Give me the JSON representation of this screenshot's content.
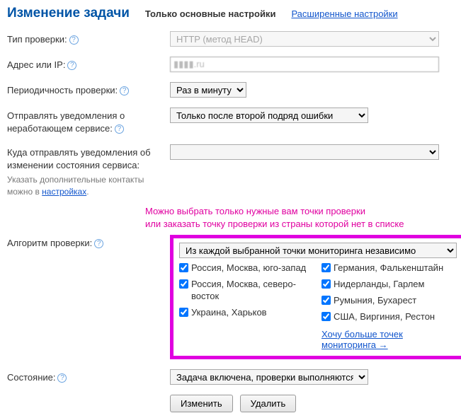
{
  "header": {
    "title": "Изменение задачи",
    "tab_basic": "Только основные настройки",
    "tab_advanced": "Расширенные настройки"
  },
  "labels": {
    "check_type": "Тип проверки:",
    "address": "Адрес или IP:",
    "frequency": "Периодичность проверки:",
    "notify_down": "Отправлять уведомления о неработающем сервисе:",
    "notify_where": "Куда отправлять уведомления об изменении состояния сервиса:",
    "notify_note_prefix": "Указать дополнительные контакты можно в ",
    "notify_note_link": "настройках",
    "algorithm": "Алгоритм проверки:",
    "state": "Состояние:"
  },
  "values": {
    "check_type": "HTTP (метод HEAD)",
    "address": "▮▮▮▮.ru",
    "frequency": "Раз в минуту",
    "notify_down": "Только после второй подряд ошибки",
    "notify_where": "",
    "algorithm_mode": "Из каждой выбранной точки мониторинга независимо",
    "state": "Задача включена, проверки выполняются"
  },
  "annotation": {
    "line1": "Можно выбрать только нужные вам точки проверки",
    "line2": "или заказать точку проверки из страны которой нет в списке"
  },
  "locations_left": [
    "Россия, Москва, юго-запад",
    "Россия, Москва, северо-восток",
    "Украина, Харьков"
  ],
  "locations_right": [
    "Германия, Фалькенштайн",
    "Нидерланды, Гарлем",
    "Румыния, Бухарест",
    "США, Виргиния, Рестон"
  ],
  "more_link": "Хочу больше точек мониторинга →",
  "buttons": {
    "submit": "Изменить",
    "delete": "Удалить"
  }
}
